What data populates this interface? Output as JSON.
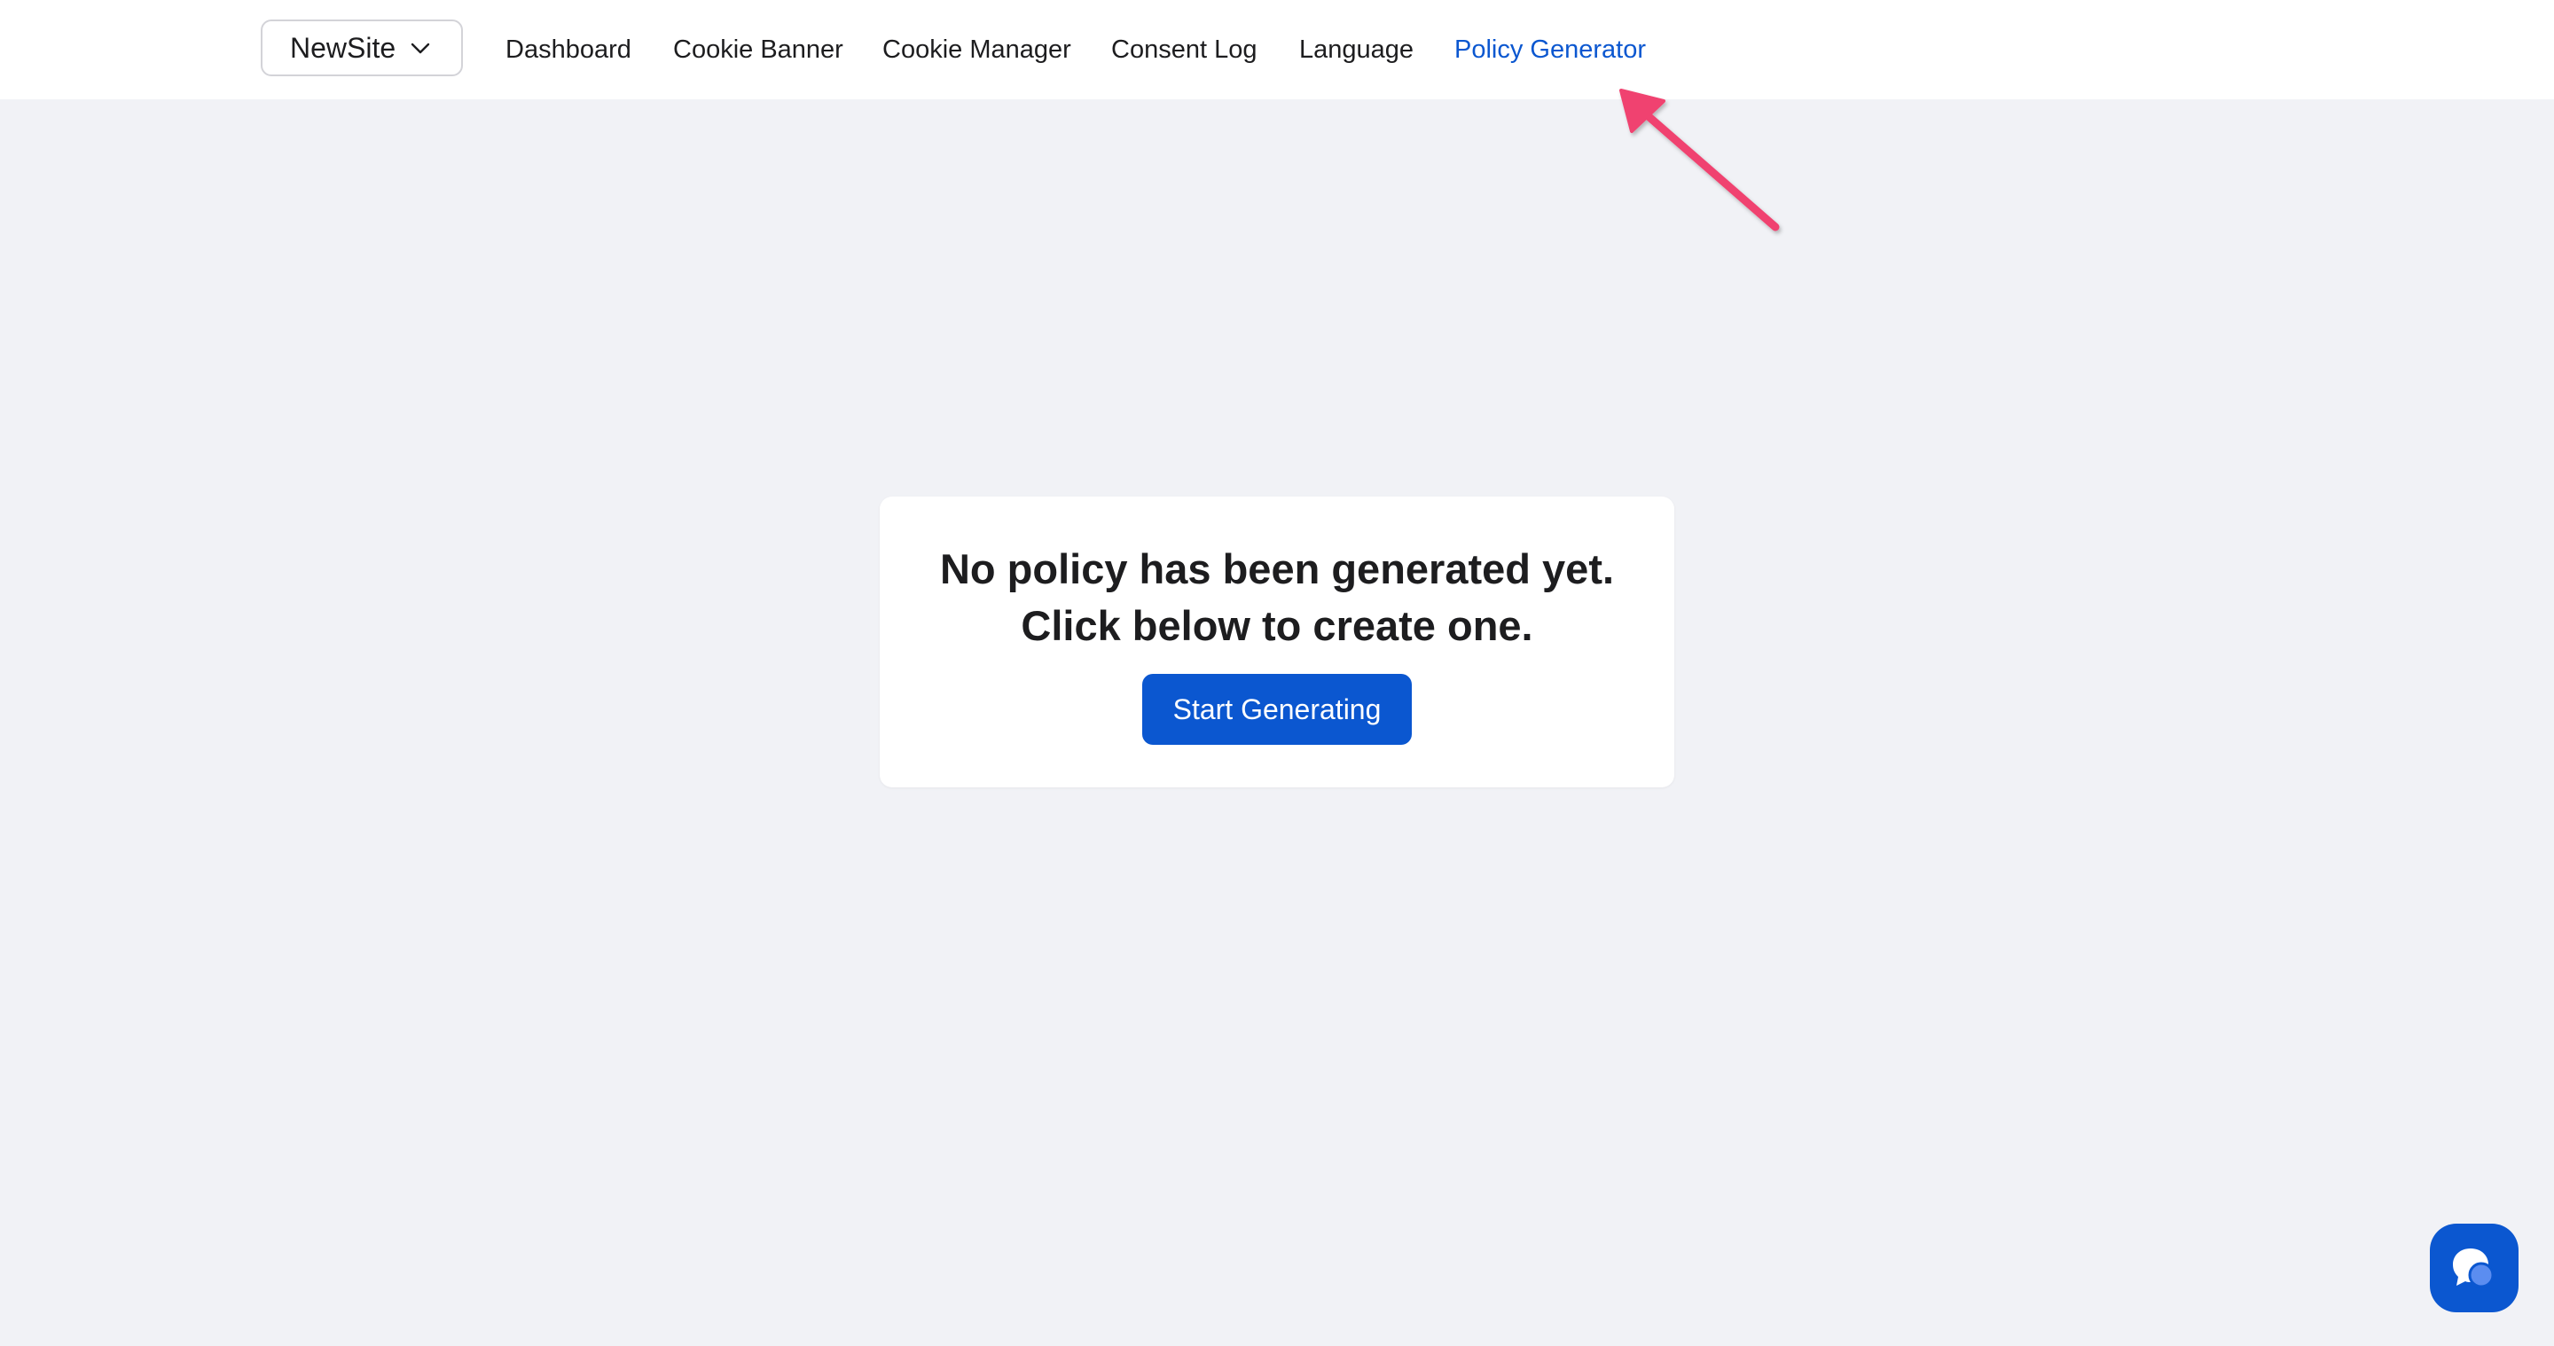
{
  "site_selector": {
    "label": "NewSite",
    "icon": "chevron-down-icon"
  },
  "nav": {
    "items": [
      {
        "label": "Dashboard",
        "active": false
      },
      {
        "label": "Cookie Banner",
        "active": false
      },
      {
        "label": "Cookie Manager",
        "active": false
      },
      {
        "label": "Consent Log",
        "active": false
      },
      {
        "label": "Language",
        "active": false
      },
      {
        "label": "Policy Generator",
        "active": true
      }
    ]
  },
  "empty_state": {
    "line1": "No policy has been generated yet.",
    "line2": "Click below to create one.",
    "button_label": "Start Generating"
  },
  "annotation": {
    "icon": "pointer-arrow-icon",
    "color": "#f0426f"
  },
  "chat_widget": {
    "icon": "chat-bubble-icon"
  },
  "colors": {
    "accent": "#0b57d0",
    "background": "#f1f2f6",
    "text": "#1d1d1f"
  }
}
